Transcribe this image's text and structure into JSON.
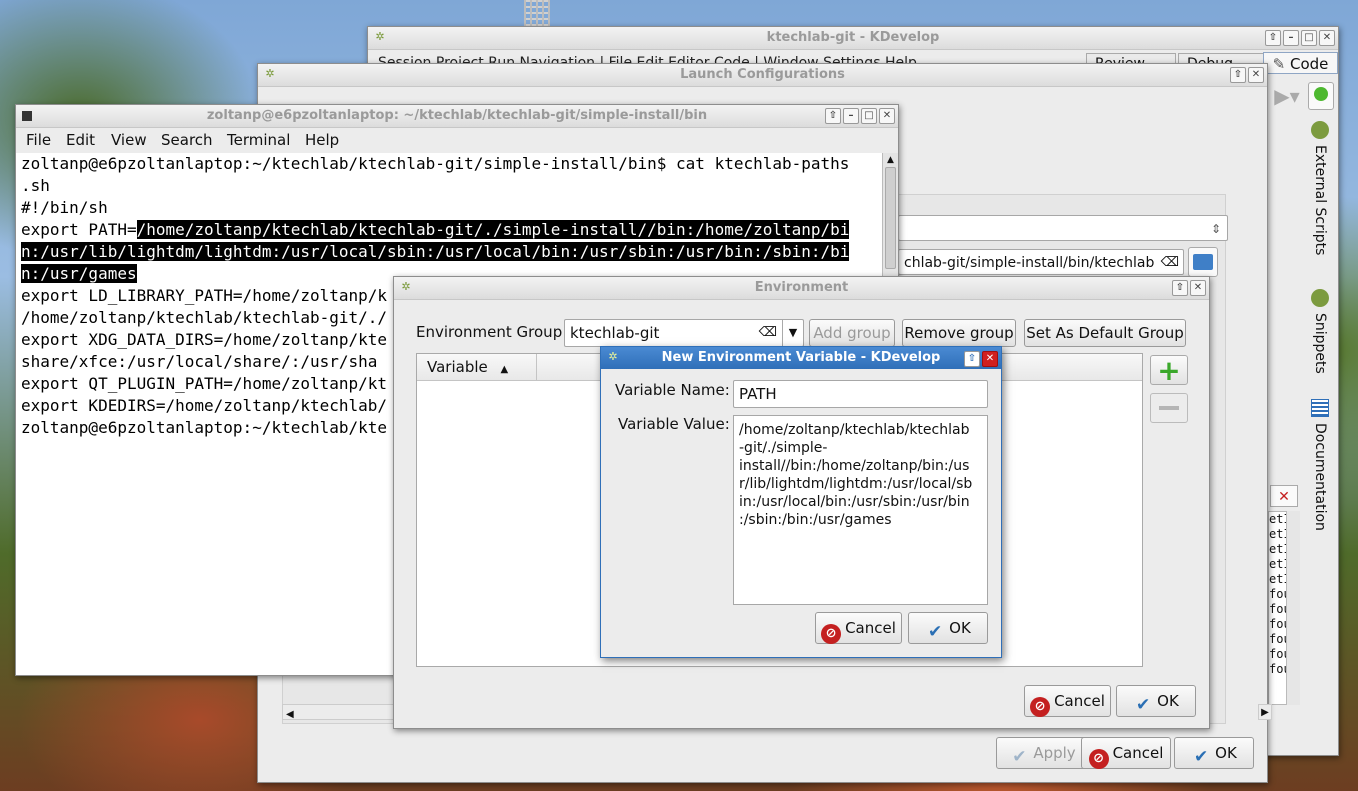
{
  "kdevelop": {
    "title": "ktechlab-git - KDevelop",
    "menu_partial": "Session  Project  Run  Navigation  |  File  Edit  Editor  Code  |  Window  Settings  Help",
    "review_tab": "Review",
    "debug_tab": "Debug",
    "code_tab": "Code",
    "side_external_scripts": "External Scripts",
    "side_snippets": "Snippets",
    "side_documentation": "Documentation",
    "bg_list_items": [
      "etI",
      "etI",
      "etI",
      "etI",
      "etI",
      "fou",
      "fou",
      "fou",
      "fou",
      "fou",
      "fou"
    ]
  },
  "launch": {
    "title": "Launch Configurations",
    "path_field_partial": "chlab-git/simple-install/bin/ktechlab",
    "apply_label": "Apply",
    "cancel_label": "Cancel",
    "ok_label": "OK"
  },
  "terminal": {
    "title": "zoltanp@e6pzoltanlaptop: ~/ktechlab/ktechlab-git/simple-install/bin",
    "menu": [
      "File",
      "Edit",
      "View",
      "Search",
      "Terminal",
      "Help"
    ],
    "lines": {
      "l1": "zoltanp@e6pzoltanlaptop:~/ktechlab/ktechlab-git/simple-install/bin$ cat ktechlab-paths",
      "l2": ".sh",
      "l3": "#!/bin/sh",
      "l4a": "export PATH=",
      "l4b": "/home/zoltanp/ktechlab/ktechlab-git/./simple-install//bin:/home/zoltanp/bi",
      "l5": "n:/usr/lib/lightdm/lightdm:/usr/local/sbin:/usr/local/bin:/usr/sbin:/usr/bin:/sbin:/bi",
      "l6": "n:/usr/games",
      "l7": "export LD_LIBRARY_PATH=/home/zoltanp/k",
      "l8": "/home/zoltanp/ktechlab/ktechlab-git/./",
      "l9": "export XDG_DATA_DIRS=/home/zoltanp/kte",
      "l10": "share/xfce:/usr/local/share/:/usr/sha",
      "l11": "export QT_PLUGIN_PATH=/home/zoltanp/kt",
      "l12": "export KDEDIRS=/home/zoltanp/ktechlab/",
      "l13": "zoltanp@e6pzoltanlaptop:~/ktechlab/kte"
    }
  },
  "environment": {
    "title": "Environment",
    "group_label": "Environment Group",
    "group_value": "ktechlab-git",
    "add_group": "Add group",
    "remove_group": "Remove group",
    "set_default": "Set As Default Group",
    "column_variable": "Variable",
    "cancel_label": "Cancel",
    "ok_label": "OK"
  },
  "new_var": {
    "title": "New Environment Variable - KDevelop",
    "name_label": "Variable Name:",
    "name_value": "PATH",
    "value_label": "Variable Value:",
    "value_lines": {
      "v1": "/home/zoltanp/ktechlab/ktechlab",
      "v2": "-git/./simple-",
      "v3": "install//bin:/home/zoltanp/bin:/us",
      "v4": "r/lib/lightdm/lightdm:/usr/local/sb",
      "v5": "in:/usr/local/bin:/usr/sbin:/usr/bin",
      "v6": ":/sbin:/bin:/usr/games"
    },
    "cancel_label": "Cancel",
    "ok_label": "OK"
  },
  "colors": {
    "title_active": "#2f6fb8",
    "cancel_red": "#c42020",
    "ok_blue": "#2a6fb4"
  }
}
